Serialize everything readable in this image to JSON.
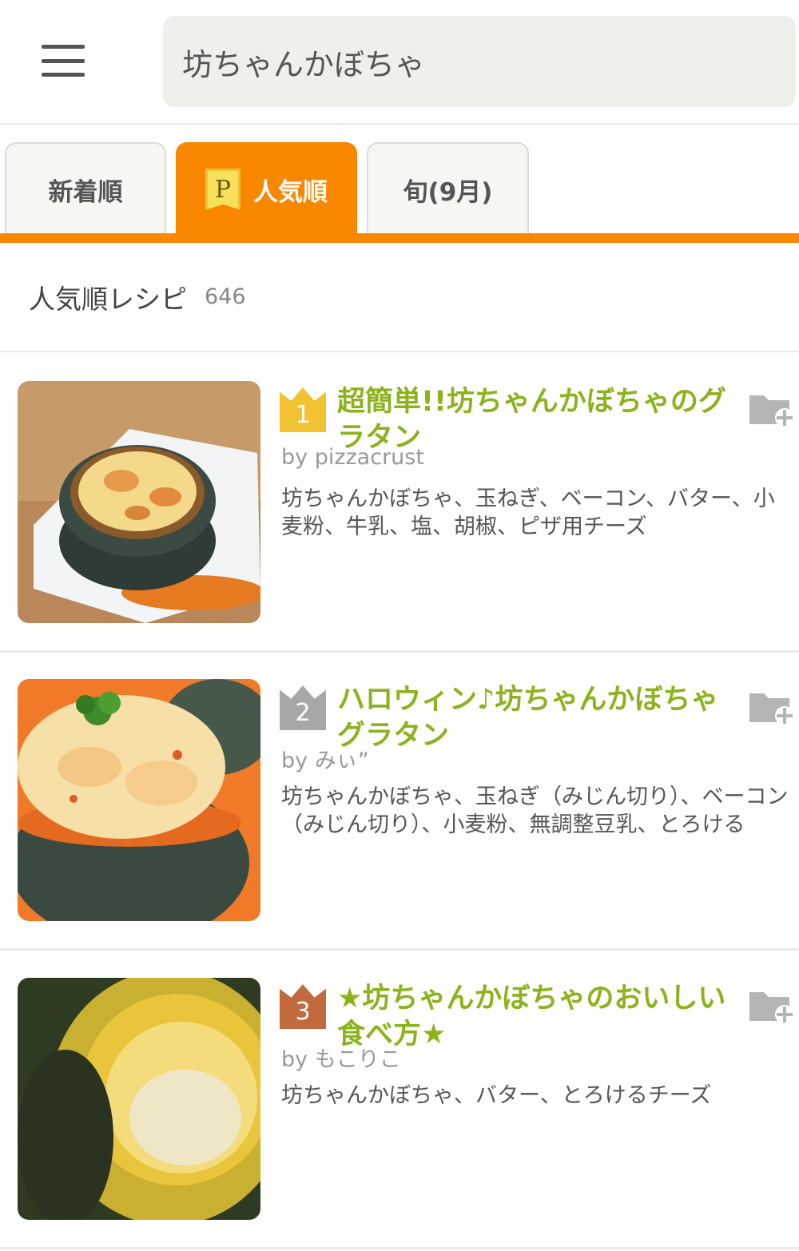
{
  "search": {
    "query": "坊ちゃんかぼちゃ"
  },
  "tabs": [
    {
      "label": "新着順"
    },
    {
      "label": "人気順",
      "badge": "P"
    },
    {
      "label": "旬(9月)"
    }
  ],
  "summary": {
    "title": "人気順レシピ",
    "count": "646"
  },
  "recipes": [
    {
      "rank": "1",
      "title": "超簡単!!坊ちゃんかぼちゃのグラタン",
      "author": "by pizzacrust",
      "ingredients": "坊ちゃんかぼちゃ、玉ねぎ、ベーコン、バター、小麦粉、牛乳、塩、胡椒、ピザ用チーズ"
    },
    {
      "rank": "2",
      "title": "ハロウィン♪坊ちゃんかぼちゃグラタン",
      "author": "by みぃ”",
      "ingredients": "坊ちゃんかぼちゃ、玉ねぎ（みじん切り）、ベーコン（みじん切り）、小麦粉、無調整豆乳、とろける"
    },
    {
      "rank": "3",
      "title": "★坊ちゃんかぼちゃのおいしい食べ方★",
      "author": "by もこりこ",
      "ingredients": "坊ちゃんかぼちゃ、バター、とろけるチーズ"
    }
  ],
  "colors": {
    "accent": "#f98700",
    "title_green": "#8cb31c",
    "gold": "#f1c232",
    "silver": "#a7a7a7",
    "bronze": "#c06a3e"
  }
}
